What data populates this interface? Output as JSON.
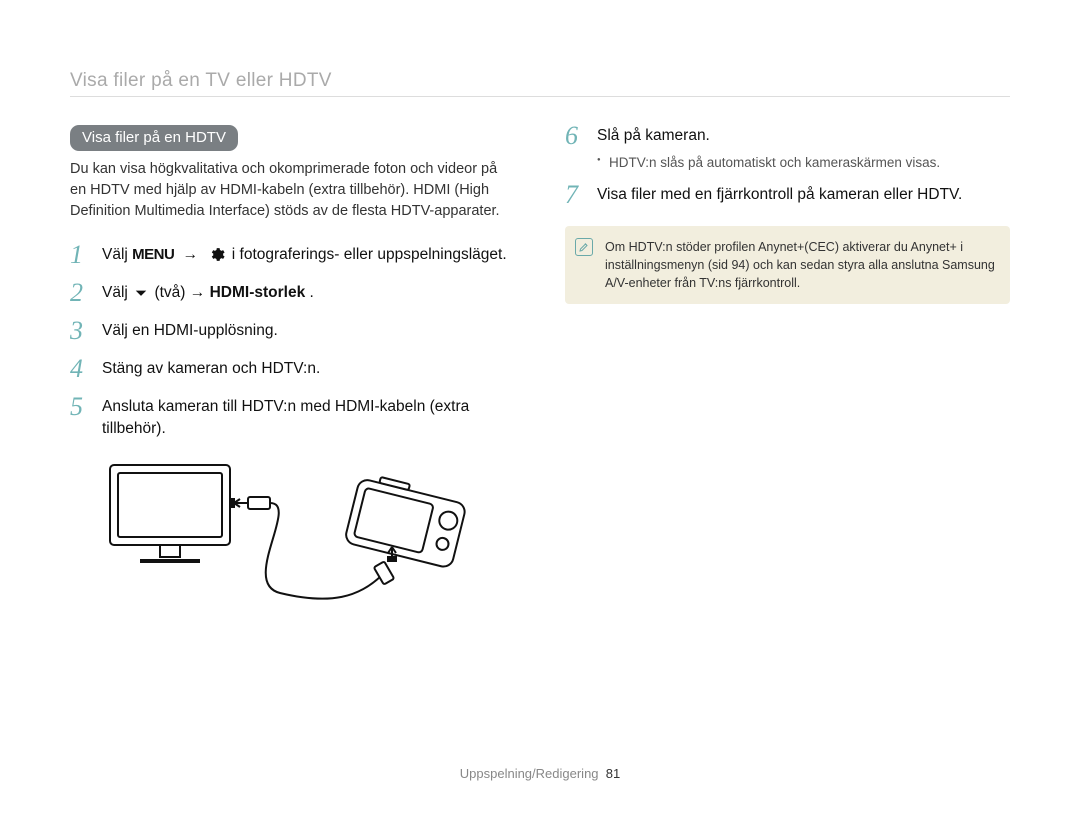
{
  "header": "Visa filer på en TV eller HDTV",
  "section_badge": "Visa filer på en HDTV",
  "intro": "Du kan visa högkvalitativa och okomprimerade foton och videor på en HDTV med hjälp av HDMI-kabeln (extra tillbehör). HDMI (High Definition Multimedia Interface) stöds av de flesta HDTV-apparater.",
  "steps_left": [
    {
      "n": "1",
      "pre": "Välj ",
      "menu": "MENU",
      "arrow": "→",
      "gear": true,
      "post": " i fotograferings- eller uppspelningsläget."
    },
    {
      "n": "2",
      "pre": "Välj ",
      "down": true,
      "mid": " (två) → ",
      "bold": "HDMI-storlek",
      "post": "."
    },
    {
      "n": "3",
      "text": "Välj en HDMI-upplösning."
    },
    {
      "n": "4",
      "text": "Stäng av kameran och HDTV:n."
    },
    {
      "n": "5",
      "text": "Ansluta kameran till HDTV:n med HDMI-kabeln (extra tillbehör)."
    }
  ],
  "steps_right": [
    {
      "n": "6",
      "text": "Slå på kameran.",
      "sub": "HDTV:n slås på automatiskt och kameraskärmen visas."
    },
    {
      "n": "7",
      "text": "Visa filer med en fjärrkontroll på kameran eller HDTV."
    }
  ],
  "note": "Om HDTV:n stöder profilen Anynet+(CEC) aktiverar du Anynet+ i inställningsmenyn (sid 94) och kan sedan styra alla anslutna Samsung A/V-enheter från TV:ns fjärrkontroll.",
  "footer_label": "Uppspelning/Redigering",
  "footer_page": "81"
}
